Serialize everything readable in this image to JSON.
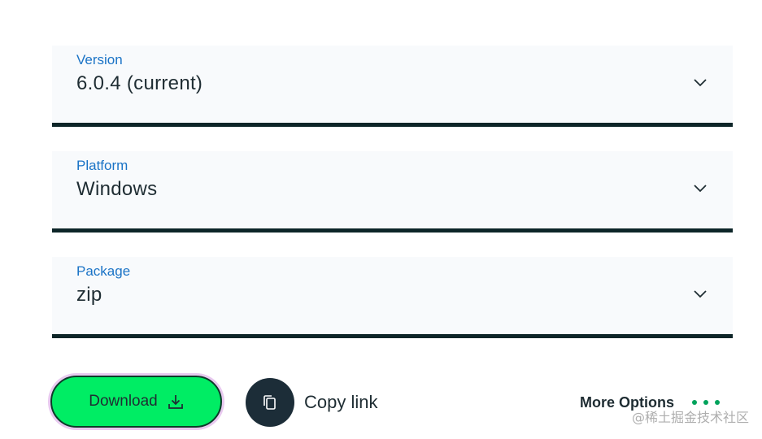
{
  "fields": [
    {
      "label": "Version",
      "value": "6.0.4 (current)"
    },
    {
      "label": "Platform",
      "value": "Windows"
    },
    {
      "label": "Package",
      "value": "zip"
    }
  ],
  "actions": {
    "download_label": "Download",
    "copy_link_label": "Copy link",
    "more_options_label": "More Options"
  },
  "icons": {
    "chevron": "chevron-down-icon",
    "download": "download-icon",
    "copy": "copy-icon",
    "more": "more-dots-icon"
  },
  "colors": {
    "label_blue": "#1a73c6",
    "download_green": "#00ed64",
    "dots_green": "#00a35c",
    "underline_dark": "#0d2528",
    "copy_circle": "#1c2d38"
  },
  "watermark": "@稀土掘金技术社区"
}
